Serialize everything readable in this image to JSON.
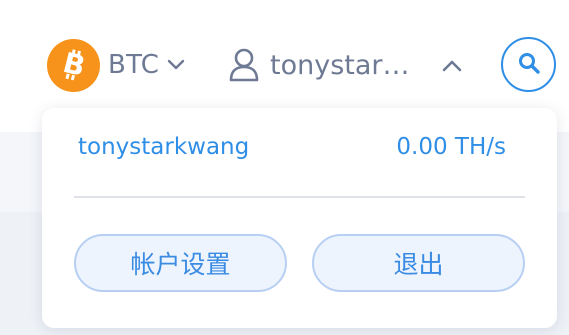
{
  "header": {
    "coin": {
      "label": "BTC",
      "icon": "bitcoin-icon",
      "icon_color": "#f7931a"
    },
    "user": {
      "display_name": "tonystark…",
      "icon": "user-icon"
    },
    "search": {
      "icon": "search-icon"
    }
  },
  "dropdown": {
    "username": "tonystarkwang",
    "hashrate": "0.00 TH/s",
    "settings_label": "帐户设置",
    "logout_label": "退出"
  },
  "colors": {
    "accent": "#2f8ee6",
    "muted_text": "#6e7a93",
    "button_bg": "#eef4fd",
    "button_border": "#b7cff3"
  }
}
